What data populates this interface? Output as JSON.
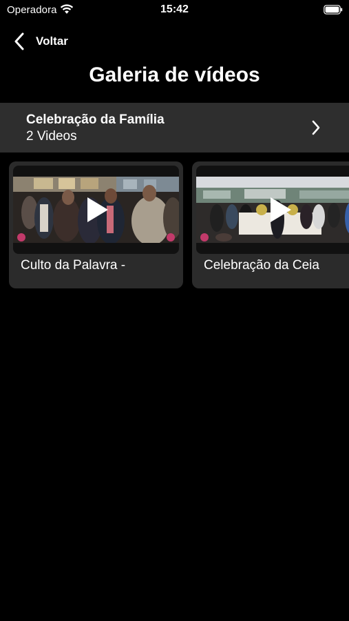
{
  "status_bar": {
    "carrier": "Operadora",
    "time": "15:42"
  },
  "nav": {
    "back_label": "Voltar",
    "title": "Galeria de vídeos"
  },
  "album": {
    "title": "Celebração da Família",
    "count": "2 Videos"
  },
  "videos": [
    {
      "title": "Culto da Palavra -"
    },
    {
      "title": "Celebração da Ceia"
    }
  ],
  "icons": {
    "wifi": "wifi-icon",
    "battery": "battery-icon",
    "back": "chevron-left-icon",
    "album_chevron": "chevron-right-icon",
    "play": "play-icon"
  }
}
